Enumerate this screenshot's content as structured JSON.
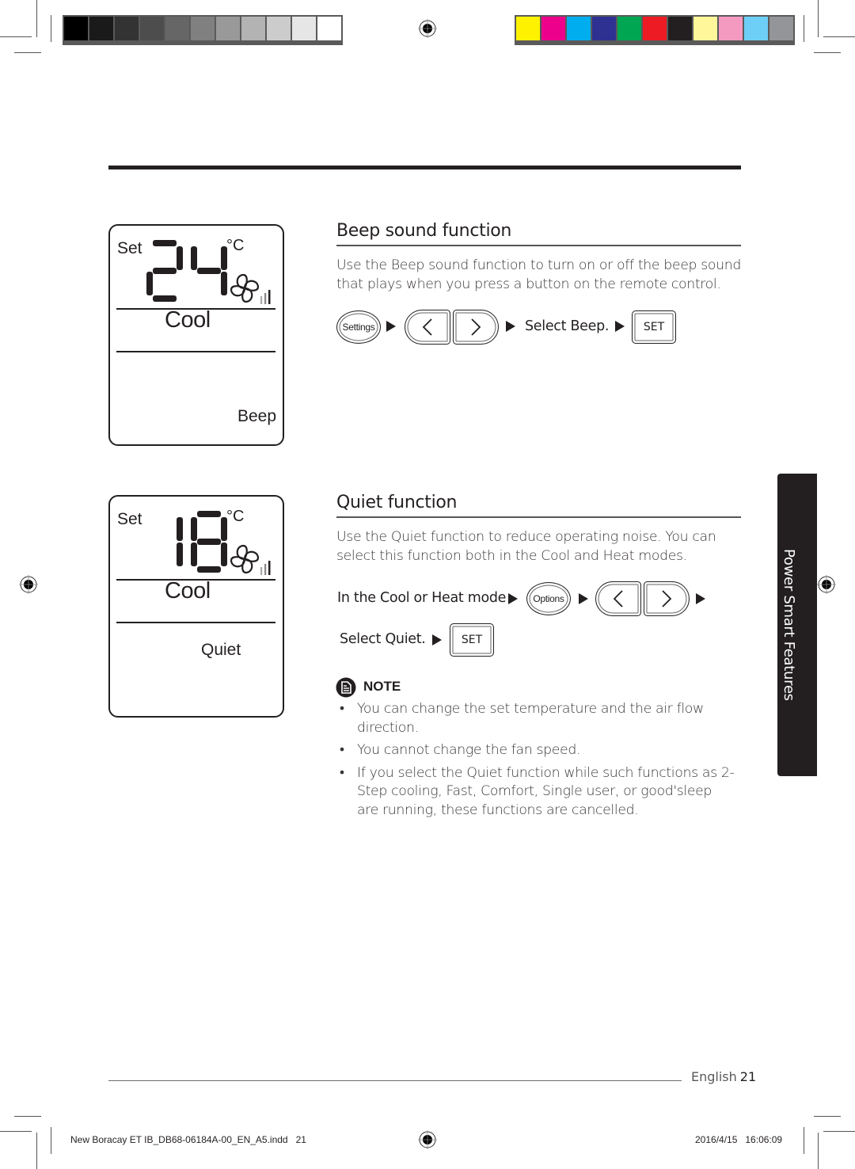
{
  "print_marks": {
    "gray_swatches": [
      "#000000",
      "#1a1a1a",
      "#333333",
      "#4d4d4d",
      "#666666",
      "#808080",
      "#999999",
      "#b3b3b3",
      "#cccccc",
      "#e6e6e6",
      "#ffffff"
    ],
    "color_swatches": [
      "#fff200",
      "#ec008c",
      "#00aeef",
      "#2e3192",
      "#00a651",
      "#ed1c24",
      "#231f20",
      "#fff799",
      "#f49ac1",
      "#6dcff6",
      "#939598"
    ]
  },
  "beep_section": {
    "title": "Beep sound function",
    "description": "Use the Beep sound function to turn on or off the beep sound that plays when you press a button on the remote control.",
    "steps": {
      "button_settings": "Settings",
      "left_icon": "chevron-left",
      "right_icon": "chevron-right",
      "select_text": "Select Beep.",
      "button_set": "SET"
    },
    "display": {
      "set_label": "Set",
      "temperature": "24",
      "unit": "°C",
      "mode": "Cool",
      "function": "Beep"
    }
  },
  "quiet_section": {
    "title": "Quiet function",
    "description": "Use the Quiet function to reduce operating noise. You can select this function both in the Cool and Heat modes.",
    "steps": {
      "mode_text": "In the Cool or Heat mode",
      "button_options": "Options",
      "left_icon": "chevron-left",
      "right_icon": "chevron-right",
      "select_text": "Select Quiet.",
      "button_set": "SET"
    },
    "display": {
      "set_label": "Set",
      "temperature": "18",
      "unit": "°C",
      "mode": "Cool",
      "function": "Quiet"
    },
    "note": {
      "title": "NOTE",
      "bullet_char": "•",
      "items": [
        "You can change the set temperature and the air flow direction.",
        "You cannot change the fan speed.",
        "If you select the Quiet function while such functions as 2-Step cooling, Fast, Comfort, Single user, or good'sleep are running, these functions are cancelled."
      ]
    }
  },
  "side_tab": {
    "label": "Power Smart Features"
  },
  "footer": {
    "language": "English",
    "page_number": "21",
    "slug_file": "New Boracay ET IB_DB68-06184A-00_EN_A5.indd   21",
    "slug_timestamp": "2016/4/15   16:06:09"
  }
}
